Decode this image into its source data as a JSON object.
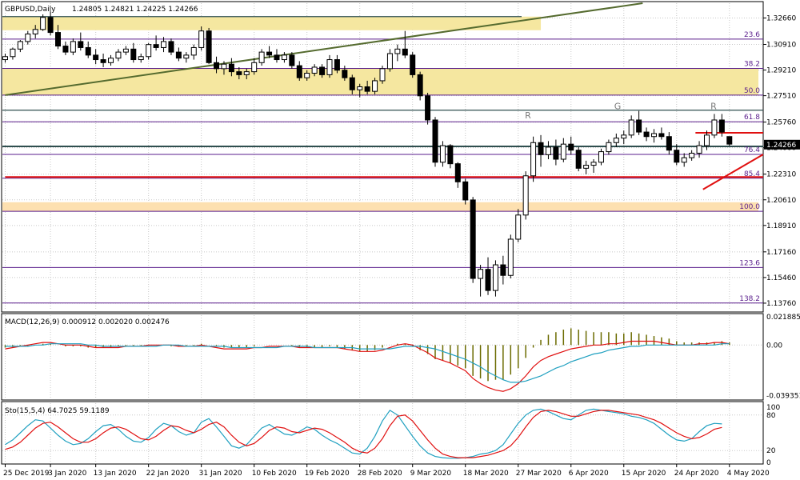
{
  "chart_data": {
    "type": "candlestick",
    "symbol_label": "GBPUSD,Daily",
    "ohlc_label": "1.24805 1.24821 1.24225 1.24266",
    "current_price_label": "1.24266",
    "current_price": 1.24266,
    "price_axis": {
      "ylim": [
        1.1328,
        1.3364
      ],
      "ticks": [
        "1.32660",
        "1.30910",
        "1.29210",
        "1.27510",
        "1.25760",
        "1.24060",
        "1.22310",
        "1.20610",
        "1.18910",
        "1.17160",
        "1.15460",
        "1.13760"
      ]
    },
    "date_axis": {
      "labels": [
        {
          "label": "25 Dec 2019",
          "index": 0
        },
        {
          "label": "3 Jan 2020",
          "index": 6
        },
        {
          "label": "13 Jan 2020",
          "index": 12
        },
        {
          "label": "22 Jan 2020",
          "index": 19
        },
        {
          "label": "31 Jan 2020",
          "index": 26
        },
        {
          "label": "10 Feb 2020",
          "index": 33
        },
        {
          "label": "19 Feb 2020",
          "index": 40
        },
        {
          "label": "28 Feb 2020",
          "index": 47
        },
        {
          "label": "9 Mar 2020",
          "index": 54
        },
        {
          "label": "18 Mar 2020",
          "index": 61
        },
        {
          "label": "27 Mar 2020",
          "index": 68
        },
        {
          "label": "6 Apr 2020",
          "index": 75
        },
        {
          "label": "15 Apr 2020",
          "index": 82
        },
        {
          "label": "24 Apr 2020",
          "index": 89
        },
        {
          "label": "4 May 2020",
          "index": 96
        }
      ]
    },
    "candles": [
      [
        1.299,
        1.303,
        1.297,
        1.301
      ],
      [
        1.301,
        1.307,
        1.299,
        1.306
      ],
      [
        1.306,
        1.312,
        1.304,
        1.311
      ],
      [
        1.311,
        1.318,
        1.309,
        1.316
      ],
      [
        1.316,
        1.322,
        1.313,
        1.319
      ],
      [
        1.319,
        1.329,
        1.318,
        1.327
      ],
      [
        1.327,
        1.331,
        1.315,
        1.317
      ],
      [
        1.317,
        1.322,
        1.306,
        1.308
      ],
      [
        1.308,
        1.311,
        1.302,
        1.304
      ],
      [
        1.304,
        1.313,
        1.302,
        1.311
      ],
      [
        1.311,
        1.317,
        1.305,
        1.307
      ],
      [
        1.307,
        1.311,
        1.3,
        1.302
      ],
      [
        1.302,
        1.306,
        1.296,
        1.299
      ],
      [
        1.299,
        1.303,
        1.294,
        1.297
      ],
      [
        1.297,
        1.302,
        1.295,
        1.3
      ],
      [
        1.3,
        1.306,
        1.298,
        1.304
      ],
      [
        1.304,
        1.308,
        1.302,
        1.306
      ],
      [
        1.306,
        1.31,
        1.297,
        1.299
      ],
      [
        1.299,
        1.303,
        1.297,
        1.301
      ],
      [
        1.301,
        1.31,
        1.299,
        1.309
      ],
      [
        1.309,
        1.315,
        1.305,
        1.307
      ],
      [
        1.307,
        1.314,
        1.304,
        1.311
      ],
      [
        1.311,
        1.313,
        1.302,
        1.304
      ],
      [
        1.304,
        1.307,
        1.298,
        1.3
      ],
      [
        1.3,
        1.304,
        1.297,
        1.302
      ],
      [
        1.302,
        1.309,
        1.299,
        1.307
      ],
      [
        1.307,
        1.321,
        1.305,
        1.318
      ],
      [
        1.318,
        1.32,
        1.296,
        1.297
      ],
      [
        1.297,
        1.301,
        1.29,
        1.293
      ],
      [
        1.293,
        1.298,
        1.289,
        1.296
      ],
      [
        1.296,
        1.3,
        1.288,
        1.291
      ],
      [
        1.291,
        1.294,
        1.286,
        1.289
      ],
      [
        1.289,
        1.293,
        1.286,
        1.291
      ],
      [
        1.291,
        1.3,
        1.289,
        1.297
      ],
      [
        1.297,
        1.306,
        1.295,
        1.304
      ],
      [
        1.304,
        1.308,
        1.3,
        1.302
      ],
      [
        1.302,
        1.306,
        1.297,
        1.299
      ],
      [
        1.299,
        1.304,
        1.297,
        1.302
      ],
      [
        1.302,
        1.304,
        1.293,
        1.295
      ],
      [
        1.295,
        1.298,
        1.285,
        1.287
      ],
      [
        1.287,
        1.292,
        1.285,
        1.29
      ],
      [
        1.29,
        1.296,
        1.288,
        1.294
      ],
      [
        1.294,
        1.296,
        1.287,
        1.289
      ],
      [
        1.289,
        1.302,
        1.287,
        1.299
      ],
      [
        1.299,
        1.302,
        1.29,
        1.292
      ],
      [
        1.292,
        1.295,
        1.285,
        1.287
      ],
      [
        1.287,
        1.289,
        1.276,
        1.279
      ],
      [
        1.279,
        1.283,
        1.274,
        1.281
      ],
      [
        1.281,
        1.285,
        1.276,
        1.278
      ],
      [
        1.278,
        1.287,
        1.276,
        1.285
      ],
      [
        1.285,
        1.295,
        1.283,
        1.293
      ],
      [
        1.293,
        1.306,
        1.291,
        1.303
      ],
      [
        1.303,
        1.309,
        1.298,
        1.306
      ],
      [
        1.306,
        1.318,
        1.3,
        1.302
      ],
      [
        1.302,
        1.304,
        1.287,
        1.289
      ],
      [
        1.289,
        1.291,
        1.272,
        1.275
      ],
      [
        1.275,
        1.277,
        1.256,
        1.259
      ],
      [
        1.259,
        1.261,
        1.228,
        1.231
      ],
      [
        1.231,
        1.245,
        1.228,
        1.242
      ],
      [
        1.242,
        1.243,
        1.227,
        1.23
      ],
      [
        1.23,
        1.231,
        1.214,
        1.218
      ],
      [
        1.218,
        1.22,
        1.203,
        1.206
      ],
      [
        1.206,
        1.208,
        1.151,
        1.154
      ],
      [
        1.154,
        1.163,
        1.142,
        1.16
      ],
      [
        1.16,
        1.168,
        1.143,
        1.146
      ],
      [
        1.146,
        1.166,
        1.142,
        1.163
      ],
      [
        1.163,
        1.169,
        1.15,
        1.156
      ],
      [
        1.156,
        1.183,
        1.154,
        1.18
      ],
      [
        1.18,
        1.2,
        1.178,
        1.196
      ],
      [
        1.196,
        1.225,
        1.193,
        1.222
      ],
      [
        1.222,
        1.248,
        1.218,
        1.244
      ],
      [
        1.244,
        1.249,
        1.228,
        1.236
      ],
      [
        1.236,
        1.245,
        1.233,
        1.241
      ],
      [
        1.241,
        1.246,
        1.229,
        1.233
      ],
      [
        1.233,
        1.247,
        1.231,
        1.243
      ],
      [
        1.243,
        1.248,
        1.236,
        1.239
      ],
      [
        1.239,
        1.241,
        1.225,
        1.227
      ],
      [
        1.227,
        1.232,
        1.223,
        1.229
      ],
      [
        1.229,
        1.233,
        1.224,
        1.231
      ],
      [
        1.231,
        1.24,
        1.229,
        1.238
      ],
      [
        1.238,
        1.246,
        1.236,
        1.244
      ],
      [
        1.244,
        1.25,
        1.241,
        1.247
      ],
      [
        1.247,
        1.252,
        1.243,
        1.249
      ],
      [
        1.249,
        1.262,
        1.247,
        1.259
      ],
      [
        1.259,
        1.265,
        1.249,
        1.251
      ],
      [
        1.251,
        1.254,
        1.245,
        1.248
      ],
      [
        1.248,
        1.253,
        1.244,
        1.25
      ],
      [
        1.25,
        1.254,
        1.246,
        1.248
      ],
      [
        1.248,
        1.251,
        1.236,
        1.239
      ],
      [
        1.239,
        1.243,
        1.229,
        1.231
      ],
      [
        1.231,
        1.237,
        1.228,
        1.234
      ],
      [
        1.234,
        1.239,
        1.232,
        1.237
      ],
      [
        1.237,
        1.245,
        1.234,
        1.242
      ],
      [
        1.242,
        1.252,
        1.239,
        1.249
      ],
      [
        1.249,
        1.263,
        1.247,
        1.259
      ],
      [
        1.259,
        1.263,
        1.248,
        1.251
      ],
      [
        1.248,
        1.248,
        1.242,
        1.243
      ]
    ],
    "fibonacci_levels": [
      {
        "label": "23.6",
        "price": 1.3126
      },
      {
        "label": "38.2",
        "price": 1.2932
      },
      {
        "label": "50.0",
        "price": 1.2755
      },
      {
        "label": "61.8",
        "price": 1.2578
      },
      {
        "label": "76.4",
        "price": 1.2362
      },
      {
        "label": "85.4",
        "price": 1.2204
      },
      {
        "label": "100.0",
        "price": 1.1985
      },
      {
        "label": "123.6",
        "price": 1.1612
      },
      {
        "label": "138.2",
        "price": 1.1377
      }
    ],
    "horizontal_levels": [
      1.3275,
      1.2655,
      1.2415
    ],
    "zones": [
      {
        "from": 1.3185,
        "to": 1.3275,
        "start": 0,
        "end": 71,
        "color": "#f5e7a0"
      },
      {
        "from": 1.2755,
        "to": 1.2932,
        "start": 0,
        "end": 138,
        "color": "#f5e7a0"
      },
      {
        "from": 1.1985,
        "to": 1.2045,
        "start": 0,
        "end": 120,
        "color": "#fde0b0"
      }
    ],
    "red_lines": [
      {
        "from": [
          91.5,
          1.2505
        ],
        "to": [
          131,
          1.2505
        ]
      },
      {
        "from": [
          0,
          1.2212
        ],
        "to": [
          128,
          1.2212
        ]
      },
      {
        "from": [
          92.5,
          1.213
        ],
        "to": [
          132,
          1.2362
        ]
      }
    ],
    "green_trendline": {
      "from": [
        0,
        1.2755
      ],
      "to": [
        84.5,
        1.3364
      ]
    },
    "pattern_labels": [
      {
        "label": "R",
        "index": 94,
        "price": 1.259
      },
      {
        "label": "G",
        "index": 110,
        "price": 1.265
      },
      {
        "label": "R",
        "index": 127,
        "price": 1.265
      }
    ],
    "macd": {
      "label": "MACD(12,26,9) 0.000912 0.002020 0.002476",
      "ticks": [
        "0.021885",
        "0.00",
        "-0.039351"
      ],
      "ylim": [
        -0.0415,
        0.0232
      ],
      "histogram": [
        -0.002,
        -0.002,
        -0.001,
        -0.001,
        0.0,
        0.001,
        0.001,
        0.0,
        -0.001,
        -0.001,
        -0.001,
        -0.002,
        -0.002,
        -0.002,
        -0.002,
        -0.001,
        -0.001,
        -0.001,
        -0.001,
        0.0,
        0.0,
        0.0,
        -0.001,
        -0.001,
        -0.001,
        -0.001,
        0.001,
        0.0,
        -0.001,
        -0.002,
        -0.002,
        -0.002,
        -0.002,
        -0.001,
        0.0,
        0.0,
        0.0,
        0.0,
        -0.001,
        -0.002,
        -0.002,
        -0.002,
        -0.002,
        -0.001,
        -0.002,
        -0.003,
        -0.004,
        -0.005,
        -0.005,
        -0.004,
        -0.002,
        0.0,
        0.001,
        0.001,
        -0.001,
        -0.004,
        -0.007,
        -0.011,
        -0.012,
        -0.014,
        -0.016,
        -0.018,
        -0.024,
        -0.026,
        -0.028,
        -0.027,
        -0.027,
        -0.023,
        -0.018,
        -0.01,
        -0.002,
        0.004,
        0.008,
        0.01,
        0.012,
        0.013,
        0.012,
        0.011,
        0.01,
        0.01,
        0.01,
        0.009,
        0.009,
        0.01,
        0.009,
        0.008,
        0.007,
        0.006,
        0.005,
        0.003,
        0.002,
        0.002,
        0.002,
        0.002,
        0.002,
        0.003,
        0.002
      ],
      "macd_line": [
        -0.003,
        -0.002,
        -0.001,
        0.0,
        0.001,
        0.002,
        0.002,
        0.001,
        0.0,
        0.0,
        0.0,
        -0.001,
        -0.002,
        -0.002,
        -0.002,
        -0.002,
        -0.001,
        -0.001,
        -0.001,
        0.0,
        0.0,
        0.0,
        0.0,
        -0.001,
        -0.001,
        -0.001,
        0.0,
        -0.001,
        -0.002,
        -0.003,
        -0.003,
        -0.003,
        -0.003,
        -0.002,
        -0.002,
        -0.001,
        -0.001,
        -0.001,
        -0.001,
        -0.002,
        -0.002,
        -0.002,
        -0.002,
        -0.002,
        -0.002,
        -0.003,
        -0.004,
        -0.005,
        -0.005,
        -0.005,
        -0.004,
        -0.002,
        0.0,
        0.001,
        0.0,
        -0.003,
        -0.006,
        -0.01,
        -0.012,
        -0.014,
        -0.017,
        -0.02,
        -0.026,
        -0.03,
        -0.033,
        -0.035,
        -0.036,
        -0.034,
        -0.03,
        -0.024,
        -0.017,
        -0.012,
        -0.009,
        -0.007,
        -0.005,
        -0.003,
        -0.002,
        -0.001,
        0.0,
        0.0,
        0.001,
        0.001,
        0.002,
        0.003,
        0.003,
        0.003,
        0.003,
        0.002,
        0.001,
        0.0,
        0.0,
        0.0,
        0.001,
        0.001,
        0.002,
        0.002,
        0.001
      ],
      "signal_line": [
        -0.001,
        -0.001,
        -0.001,
        -0.001,
        0.0,
        0.0,
        0.001,
        0.001,
        0.001,
        0.001,
        0.001,
        0.0,
        0.0,
        -0.001,
        -0.001,
        -0.001,
        -0.001,
        -0.001,
        -0.001,
        -0.001,
        -0.001,
        0.0,
        0.0,
        0.0,
        -0.001,
        -0.001,
        -0.001,
        -0.001,
        -0.001,
        -0.001,
        -0.002,
        -0.002,
        -0.002,
        -0.002,
        -0.002,
        -0.002,
        -0.002,
        -0.001,
        -0.001,
        -0.001,
        -0.001,
        -0.002,
        -0.002,
        -0.002,
        -0.002,
        -0.002,
        -0.002,
        -0.003,
        -0.003,
        -0.003,
        -0.003,
        -0.003,
        -0.002,
        -0.001,
        -0.001,
        -0.001,
        -0.002,
        -0.003,
        -0.005,
        -0.007,
        -0.009,
        -0.011,
        -0.014,
        -0.017,
        -0.021,
        -0.024,
        -0.027,
        -0.029,
        -0.029,
        -0.028,
        -0.026,
        -0.024,
        -0.021,
        -0.018,
        -0.016,
        -0.013,
        -0.011,
        -0.009,
        -0.007,
        -0.006,
        -0.004,
        -0.003,
        -0.002,
        -0.001,
        -0.001,
        0.0,
        0.0,
        0.0,
        0.0,
        0.0,
        0.0,
        0.0,
        0.0,
        0.0,
        0.0,
        0.001,
        0.001
      ]
    },
    "stochastic": {
      "label": "Sto(15,5,4) 64.7025 59.1189",
      "ticks": [
        "100",
        "80",
        "20",
        "0"
      ],
      "ylim": [
        0,
        100
      ],
      "k_line": [
        30,
        38,
        50,
        62,
        72,
        70,
        58,
        46,
        36,
        30,
        32,
        40,
        52,
        62,
        64,
        56,
        44,
        36,
        34,
        42,
        56,
        66,
        62,
        52,
        46,
        50,
        68,
        74,
        60,
        44,
        28,
        24,
        30,
        44,
        58,
        64,
        56,
        48,
        46,
        52,
        60,
        56,
        46,
        38,
        32,
        24,
        16,
        14,
        24,
        44,
        70,
        88,
        80,
        62,
        44,
        28,
        16,
        10,
        8,
        7,
        7,
        8,
        10,
        14,
        16,
        20,
        30,
        48,
        66,
        80,
        88,
        90,
        86,
        80,
        74,
        72,
        80,
        88,
        90,
        88,
        86,
        84,
        82,
        78,
        76,
        72,
        66,
        56,
        46,
        38,
        36,
        40,
        52,
        62,
        66,
        65
      ],
      "d_line": [
        22,
        26,
        34,
        46,
        58,
        66,
        68,
        60,
        50,
        40,
        34,
        34,
        40,
        50,
        58,
        60,
        56,
        48,
        40,
        38,
        44,
        54,
        62,
        60,
        54,
        50,
        56,
        64,
        68,
        60,
        46,
        34,
        28,
        32,
        42,
        54,
        60,
        58,
        52,
        50,
        54,
        58,
        56,
        50,
        42,
        34,
        24,
        18,
        16,
        24,
        40,
        62,
        78,
        80,
        70,
        54,
        38,
        24,
        14,
        10,
        8,
        8,
        8,
        10,
        12,
        16,
        20,
        28,
        42,
        60,
        76,
        86,
        88,
        86,
        82,
        78,
        78,
        82,
        86,
        88,
        88,
        86,
        84,
        82,
        80,
        76,
        72,
        66,
        58,
        50,
        44,
        40,
        42,
        48,
        56,
        59
      ]
    }
  }
}
